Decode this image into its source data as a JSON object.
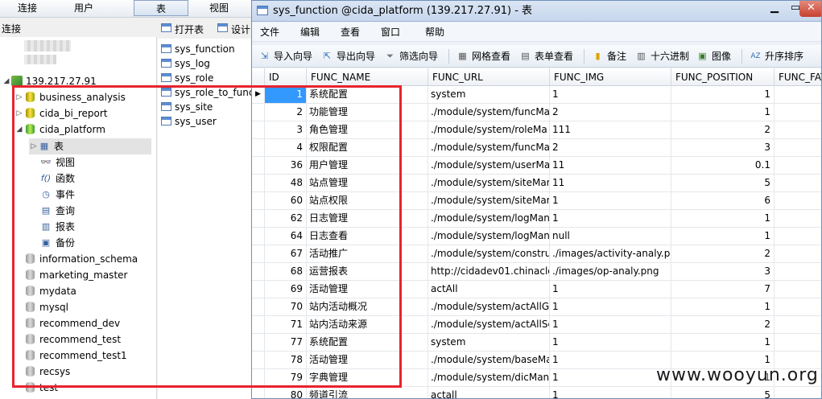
{
  "main_toolbar": {
    "connect": "连接",
    "user": "用户",
    "table": "表",
    "view": "视图"
  },
  "connection_label": "连接",
  "tree": {
    "server": "139.217.27.91",
    "databases": [
      {
        "name": "business_analysis",
        "expanded": false
      },
      {
        "name": "cida_bi_report",
        "expanded": false
      },
      {
        "name": "cida_platform",
        "expanded": true
      }
    ],
    "children": [
      {
        "label": "表",
        "icon": "table-icon",
        "selected": true
      },
      {
        "label": "视图",
        "icon": "view-icon"
      },
      {
        "label": "函数",
        "icon": "function-icon"
      },
      {
        "label": "事件",
        "icon": "event-icon"
      },
      {
        "label": "查询",
        "icon": "query-icon"
      },
      {
        "label": "报表",
        "icon": "report-icon"
      },
      {
        "label": "备份",
        "icon": "backup-icon"
      }
    ],
    "other_databases": [
      "information_schema",
      "marketing_master",
      "mydata",
      "mysql",
      "recommend_dev",
      "recommend_test",
      "recommend_test1",
      "recsys",
      "test"
    ]
  },
  "object_toolbar": {
    "open": "打开表",
    "design": "设计"
  },
  "object_list": [
    "sys_function",
    "sys_log",
    "sys_role",
    "sys_role_to_func",
    "sys_site",
    "sys_user"
  ],
  "window": {
    "title": "sys_function @cida_platform (139.217.27.91) - 表"
  },
  "menu": [
    "文件",
    "编辑",
    "查看",
    "窗口",
    "帮助"
  ],
  "toolbar": {
    "import": "导入向导",
    "export": "导出向导",
    "filter": "筛选向导",
    "grid_view": "网格查看",
    "form_view": "表单查看",
    "memo": "备注",
    "hex": "十六进制",
    "image": "图像",
    "sort": "升序排序"
  },
  "grid": {
    "columns": [
      "ID",
      "FUNC_NAME",
      "FUNC_URL",
      "FUNC_IMG",
      "FUNC_POSITION",
      "FUNC_FAT"
    ],
    "rows": [
      [
        "1",
        "系统配置",
        "system",
        "1",
        "1"
      ],
      [
        "2",
        "功能管理",
        "./module/system/funcMa",
        "2",
        "1"
      ],
      [
        "3",
        "角色管理",
        "./module/system/roleMa",
        "111",
        "2"
      ],
      [
        "4",
        "权限配置",
        "./module/system/funcMa",
        "2",
        "3"
      ],
      [
        "36",
        "用户管理",
        "./module/system/userMa",
        "11",
        "0.1"
      ],
      [
        "48",
        "站点管理",
        "./module/system/siteMar",
        "11",
        "5"
      ],
      [
        "60",
        "站点权限",
        "./module/system/siteMar",
        "1",
        "6"
      ],
      [
        "62",
        "日志管理",
        "./module/system/logMan",
        "1",
        "1"
      ],
      [
        "64",
        "日志查看",
        "./module/system/logMan",
        "null",
        "1"
      ],
      [
        "67",
        "活动推广",
        "./module/system/constru",
        "./images/activity-analy.pn",
        "2"
      ],
      [
        "68",
        "运营报表",
        "http://cidadev01.chinaclo",
        "./images/op-analy.png",
        "3"
      ],
      [
        "69",
        "活动管理",
        "actAll",
        "1",
        "7"
      ],
      [
        "70",
        "站内活动概况",
        "./module/system/actAllGe",
        "1",
        "1"
      ],
      [
        "71",
        "站内活动来源",
        "./module/system/actAllSc",
        "1",
        "2"
      ],
      [
        "77",
        "系统配置",
        "system",
        "1",
        "1"
      ],
      [
        "78",
        "活动管理",
        "./module/system/baseMa",
        "1",
        "1"
      ],
      [
        "79",
        "字典管理",
        "./module/system/dicMan",
        "1",
        "1"
      ],
      [
        "80",
        "频道引流",
        "actall",
        "1",
        "5"
      ]
    ]
  },
  "watermark": "www.wooyun.org"
}
